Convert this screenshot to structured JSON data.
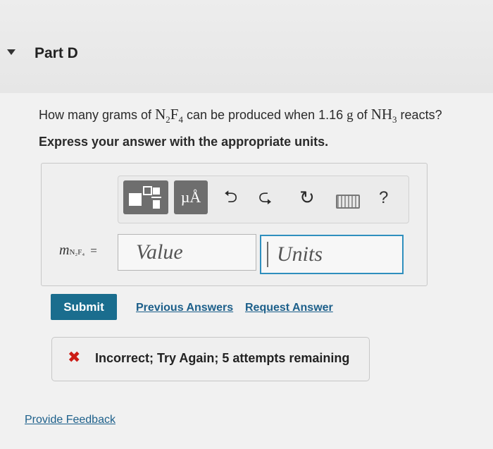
{
  "part": {
    "title": "Part D"
  },
  "question": {
    "text_pre": "How many grams of",
    "formula1": "N",
    "formula1_sub1": "2",
    "formula1_mid": "F",
    "formula1_sub2": "4",
    "text_mid": "can be produced when 1.16",
    "unit_g": "g",
    "text_of": "of",
    "formula2": "NH",
    "formula2_sub": "3",
    "text_post": "reacts?"
  },
  "instruction": "Express your answer with the appropriate units.",
  "toolbar": {
    "units_label": "µÅ",
    "undo_icon": "undo-icon",
    "redo_icon": "redo-icon",
    "reset_icon": "reset-icon",
    "keyboard_icon": "keyboard-icon",
    "help_label": "?"
  },
  "answer": {
    "var": "m",
    "var_sub": "N₂F₄",
    "equals": "=",
    "value_placeholder": "Value",
    "units_placeholder": "Units"
  },
  "actions": {
    "submit": "Submit",
    "previous_answers": "Previous Answers",
    "request_answer": "Request Answer"
  },
  "feedback": {
    "status_icon": "x-icon",
    "status_color": "#cc1d16",
    "message": "Incorrect; Try Again; 5 attempts remaining"
  },
  "footer": {
    "provide_feedback": "Provide Feedback"
  },
  "colors": {
    "accent": "#1a6d8e",
    "link": "#1c5f8a",
    "focus": "#2f8fbe"
  }
}
